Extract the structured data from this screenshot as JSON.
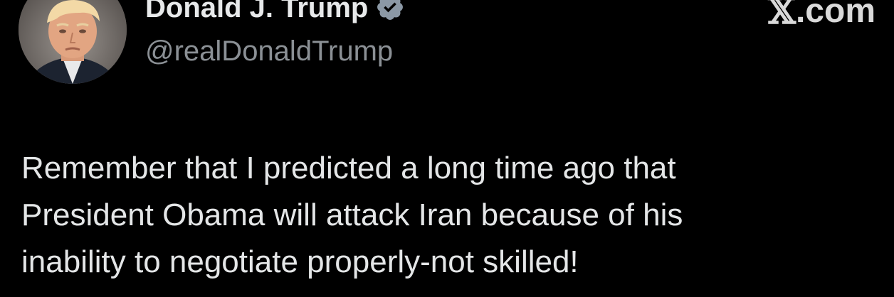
{
  "author": {
    "display_name": "Donald J. Trump",
    "handle": "@realDonaldTrump",
    "verified": true,
    "avatar_icon": "profile-photo",
    "verified_icon": "verified-badge-icon"
  },
  "brand": {
    "mark": "𝕏",
    "domain": ".com"
  },
  "tweet": {
    "text": "Remember that I predicted a long time ago that\nPresident Obama will attack Iran because of his\ninability to negotiate properly-not skilled!"
  },
  "colors": {
    "background": "#000000",
    "primary_text": "#e7e9ea",
    "secondary_text": "#8b9095",
    "badge": "#8b98a5"
  }
}
